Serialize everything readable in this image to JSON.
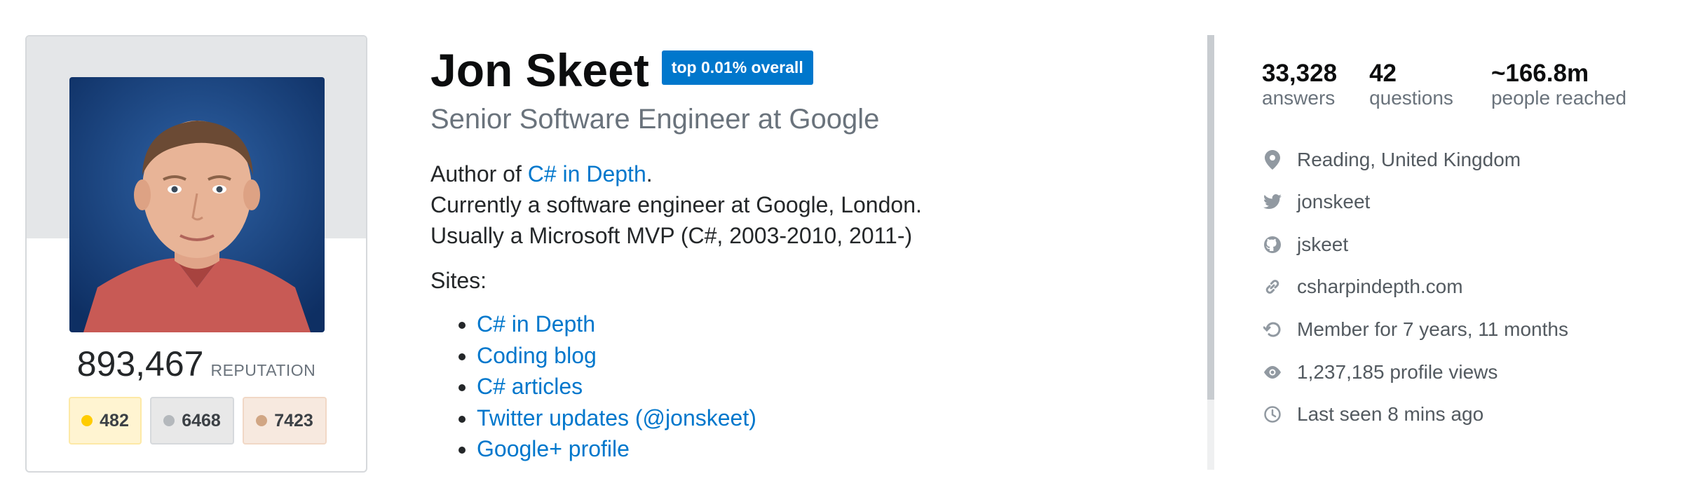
{
  "profile": {
    "reputation": "893,467",
    "reputation_label": "REPUTATION",
    "badges": {
      "gold": "482",
      "silver": "6468",
      "bronze": "7423"
    },
    "name": "Jon Skeet",
    "rank_tag": "top 0.01% overall",
    "title": "Senior Software Engineer at Google",
    "bio": {
      "author_prefix": "Author of ",
      "author_link": "C# in Depth",
      "author_suffix": ".",
      "line2": "Currently a software engineer at Google, London.",
      "line3": "Usually a Microsoft MVP (C#, 2003-2010, 2011-)"
    },
    "sites_label": "Sites:",
    "sites": [
      "C# in Depth",
      "Coding blog",
      "C# articles",
      "Twitter updates (@jonskeet)",
      "Google+ profile"
    ]
  },
  "stats": [
    {
      "value": "33,328",
      "label": "answers"
    },
    {
      "value": "42",
      "label": "questions"
    },
    {
      "value": "~166.8m",
      "label": "people reached"
    }
  ],
  "info": [
    {
      "icon": "location-pin-icon",
      "text": "Reading, United Kingdom"
    },
    {
      "icon": "twitter-icon",
      "text": "jonskeet"
    },
    {
      "icon": "github-icon",
      "text": "jskeet"
    },
    {
      "icon": "link-icon",
      "text": "csharpindepth.com"
    },
    {
      "icon": "history-icon",
      "text": "Member for 7 years, 11 months"
    },
    {
      "icon": "eye-icon",
      "text": "1,237,185 profile views"
    },
    {
      "icon": "clock-icon",
      "text": "Last seen 8 mins ago"
    }
  ],
  "colors": {
    "link": "#0077cc",
    "rank_tag_bg": "#0077cc",
    "muted_text": "#6a737c",
    "gold_badge": "#ffcc01",
    "silver_badge": "#b4b8bc",
    "bronze_badge": "#d1a684"
  }
}
